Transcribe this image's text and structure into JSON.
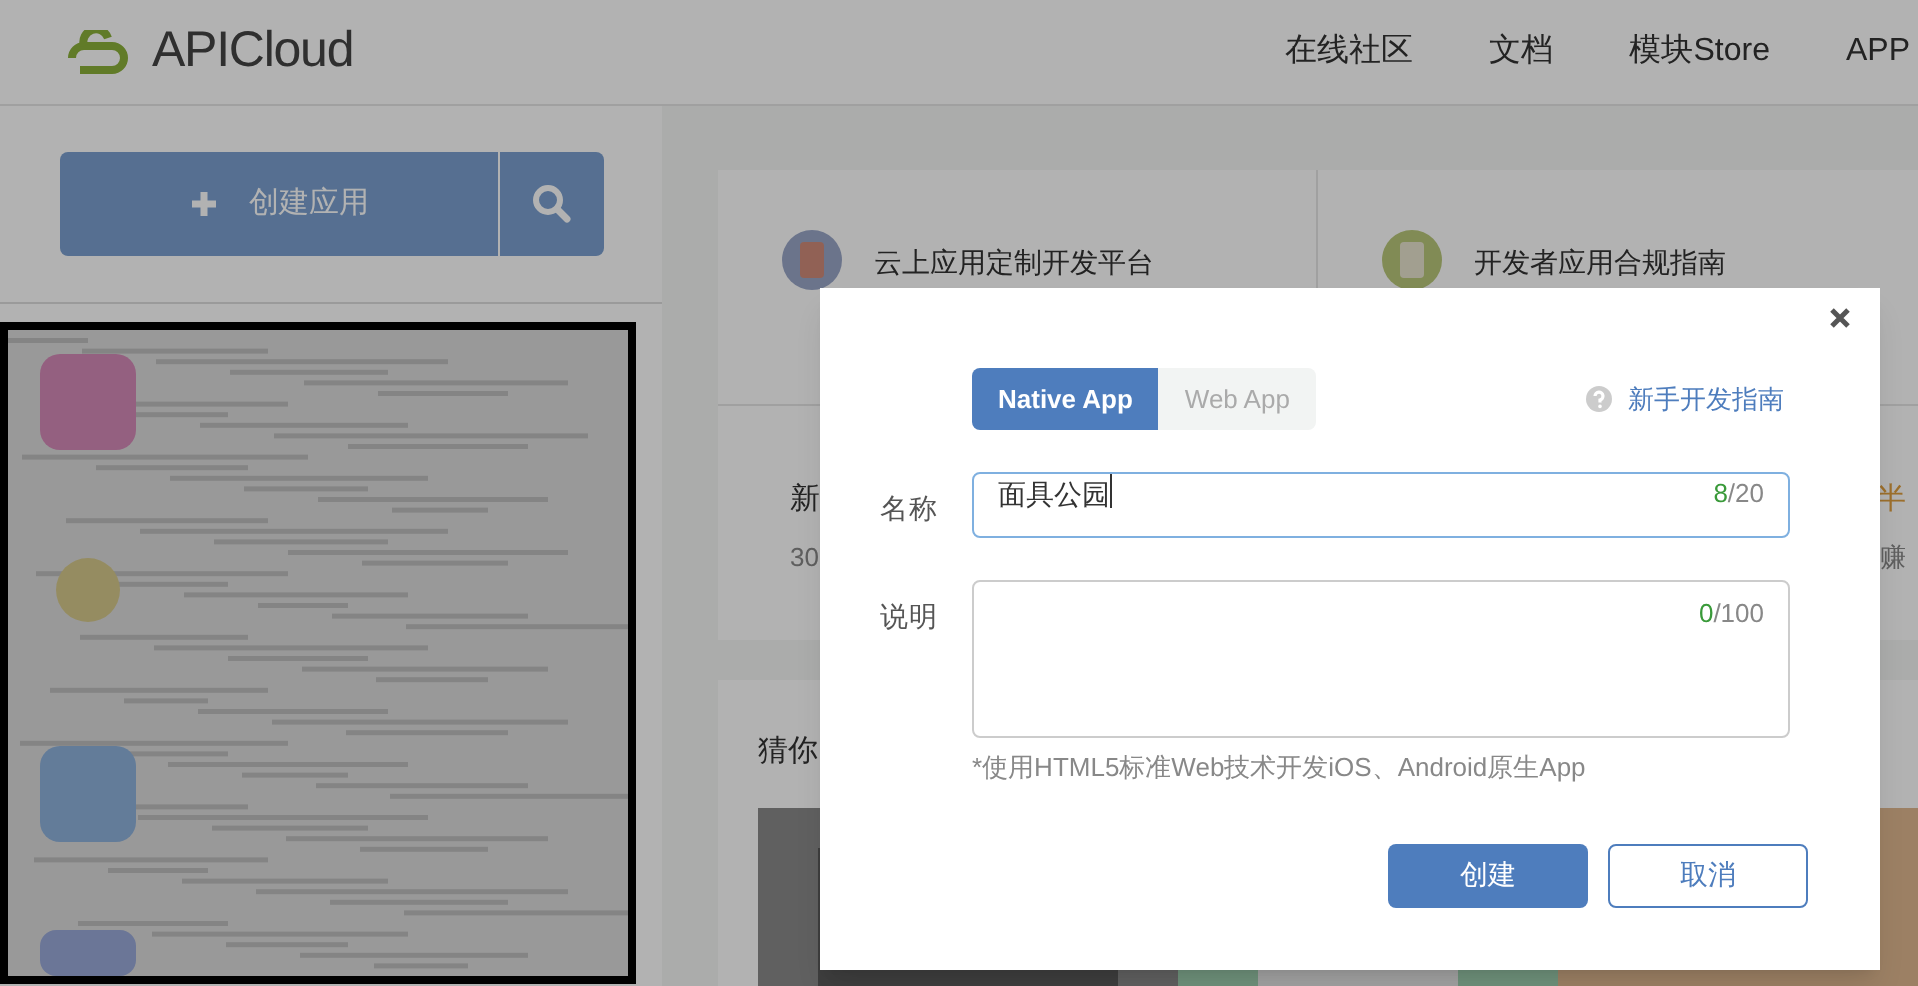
{
  "header": {
    "logo": "APICloud",
    "nav": [
      {
        "label": "在线社区"
      },
      {
        "label": "文档"
      },
      {
        "label": "模块Store"
      },
      {
        "label": "APP"
      }
    ]
  },
  "sidebar": {
    "create_button": "创建应用"
  },
  "cards": [
    {
      "title": "云上应用定制开发平台"
    },
    {
      "title": "开发者应用合规指南"
    }
  ],
  "promos": [
    {
      "title": "新",
      "subtitle": "30"
    },
    {
      "title": "半",
      "subtitle": "赚"
    }
  ],
  "recommend": {
    "title": "猜你"
  },
  "dialog": {
    "tabs": [
      {
        "label": "Native App",
        "selected": true
      },
      {
        "label": "Web App",
        "selected": false
      }
    ],
    "help": "新手开发指南",
    "fields": [
      {
        "label": "名称",
        "kind": "input",
        "value": "面具公园",
        "count": "8",
        "limit": "/20"
      },
      {
        "label": "说明",
        "kind": "textarea",
        "count": "0",
        "limit": "/100"
      }
    ],
    "hint": "*使用HTML5标准Web技术开发iOS、Android原生App",
    "buttons": [
      {
        "label": "创建",
        "kind": "primary"
      },
      {
        "label": "取消",
        "kind": "secondary"
      }
    ]
  }
}
